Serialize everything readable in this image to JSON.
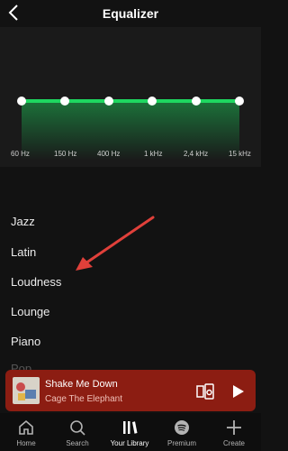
{
  "header": {
    "title": "Equalizer"
  },
  "equalizer": {
    "bands": [
      "60 Hz",
      "150 Hz",
      "400 Hz",
      "1 kHz",
      "2,4 kHz",
      "15 kHz"
    ],
    "accent_color": "#1ed760"
  },
  "presets": [
    "Jazz",
    "Latin",
    "Loudness",
    "Lounge",
    "Piano",
    "Pop"
  ],
  "now_playing": {
    "track": "Shake Me Down",
    "artist": "Cage The Elephant",
    "background_color": "#8c1d12"
  },
  "nav": {
    "tabs": [
      {
        "label": "Home",
        "icon": "home-icon"
      },
      {
        "label": "Search",
        "icon": "search-icon"
      },
      {
        "label": "Your Library",
        "icon": "library-icon"
      },
      {
        "label": "Premium",
        "icon": "spotify-icon"
      },
      {
        "label": "Create",
        "icon": "plus-icon"
      }
    ],
    "active": "Your Library"
  }
}
